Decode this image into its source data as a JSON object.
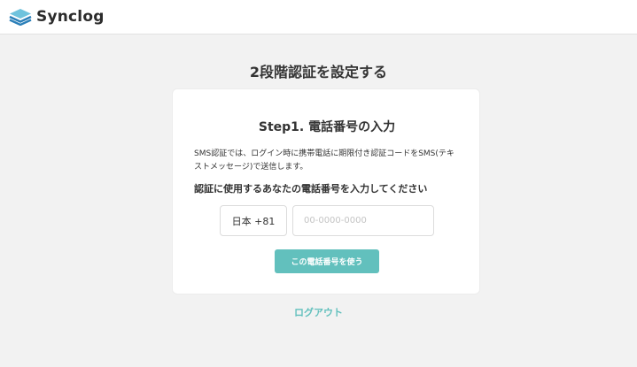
{
  "header": {
    "app_name": "Synclog",
    "logo_icon": "layers-icon",
    "brand_color": "#2b7fb8"
  },
  "page": {
    "title": "2段階認証を設定する"
  },
  "card": {
    "step_title": "Step1. 電話番号の入力",
    "description": "SMS認証では、ログイン時に携帯電話に期限付き認証コードをSMS(テキストメッセージ)で送信します。",
    "prompt": "認証に使用するあなたの電話番号を入力してください",
    "country_code": "日本 +81",
    "phone_value": "",
    "phone_placeholder": "00-0000-0000",
    "submit_label": "この電話番号を使う",
    "accent_color": "#62c0bd"
  },
  "footer": {
    "logout_label": "ログアウト"
  }
}
